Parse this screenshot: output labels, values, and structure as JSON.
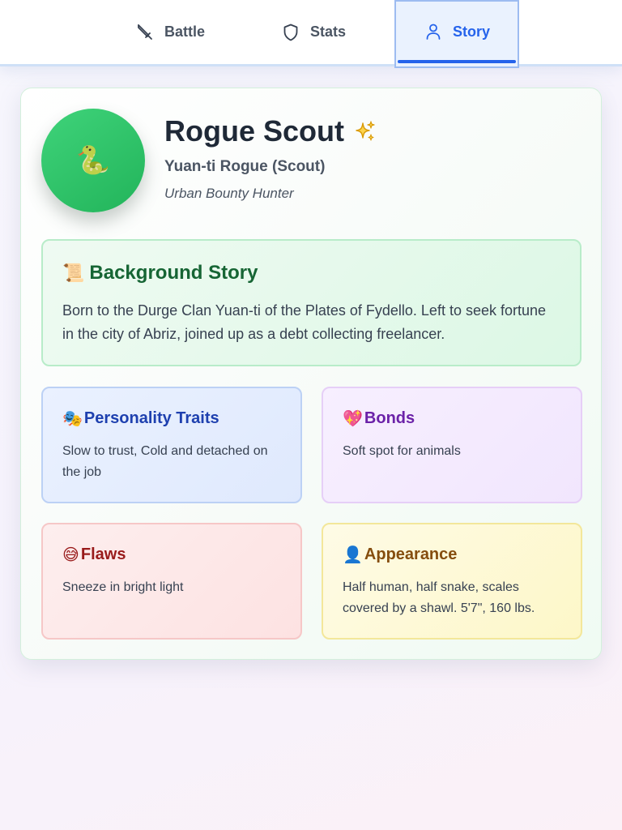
{
  "tabs": {
    "battle": {
      "label": "Battle",
      "icon": "sword-icon"
    },
    "stats": {
      "label": "Stats",
      "icon": "shield-icon"
    },
    "story": {
      "label": "Story",
      "icon": "user-icon",
      "active": true
    }
  },
  "character": {
    "avatar_emoji": "🐍",
    "name": "Rogue Scout",
    "name_icon": "sparkles-icon",
    "subtitle": "Yuan-ti Rogue (Scout)",
    "tagline": "Urban Bounty Hunter"
  },
  "background": {
    "emoji": "📜",
    "title": "Background Story",
    "text": "Born to the Durge Clan Yuan-ti of the Plates of Fydello. Left to seek fortune in the city of Abriz, joined up as a debt collecting freelancer."
  },
  "traits": {
    "emoji": "🎭",
    "title": "Personality Traits",
    "text": "Slow to trust, Cold and detached on the job"
  },
  "bonds": {
    "emoji": "💖",
    "title": "Bonds",
    "text": "Soft spot for animals"
  },
  "flaws": {
    "emoji": "😅",
    "title": "Flaws",
    "text": "Sneeze in bright light"
  },
  "appearance": {
    "emoji": "👤",
    "title": "Appearance",
    "text": "Half human, half snake, scales covered by a shawl. 5'7\", 160 lbs."
  },
  "colors": {
    "accent": "#2563eb",
    "avatar": "#22b45a",
    "background_title": "#166534",
    "traits_title": "#1e40af",
    "bonds_title": "#6b21a8",
    "flaws_title": "#991b1b",
    "appearance_title": "#854d0e"
  }
}
